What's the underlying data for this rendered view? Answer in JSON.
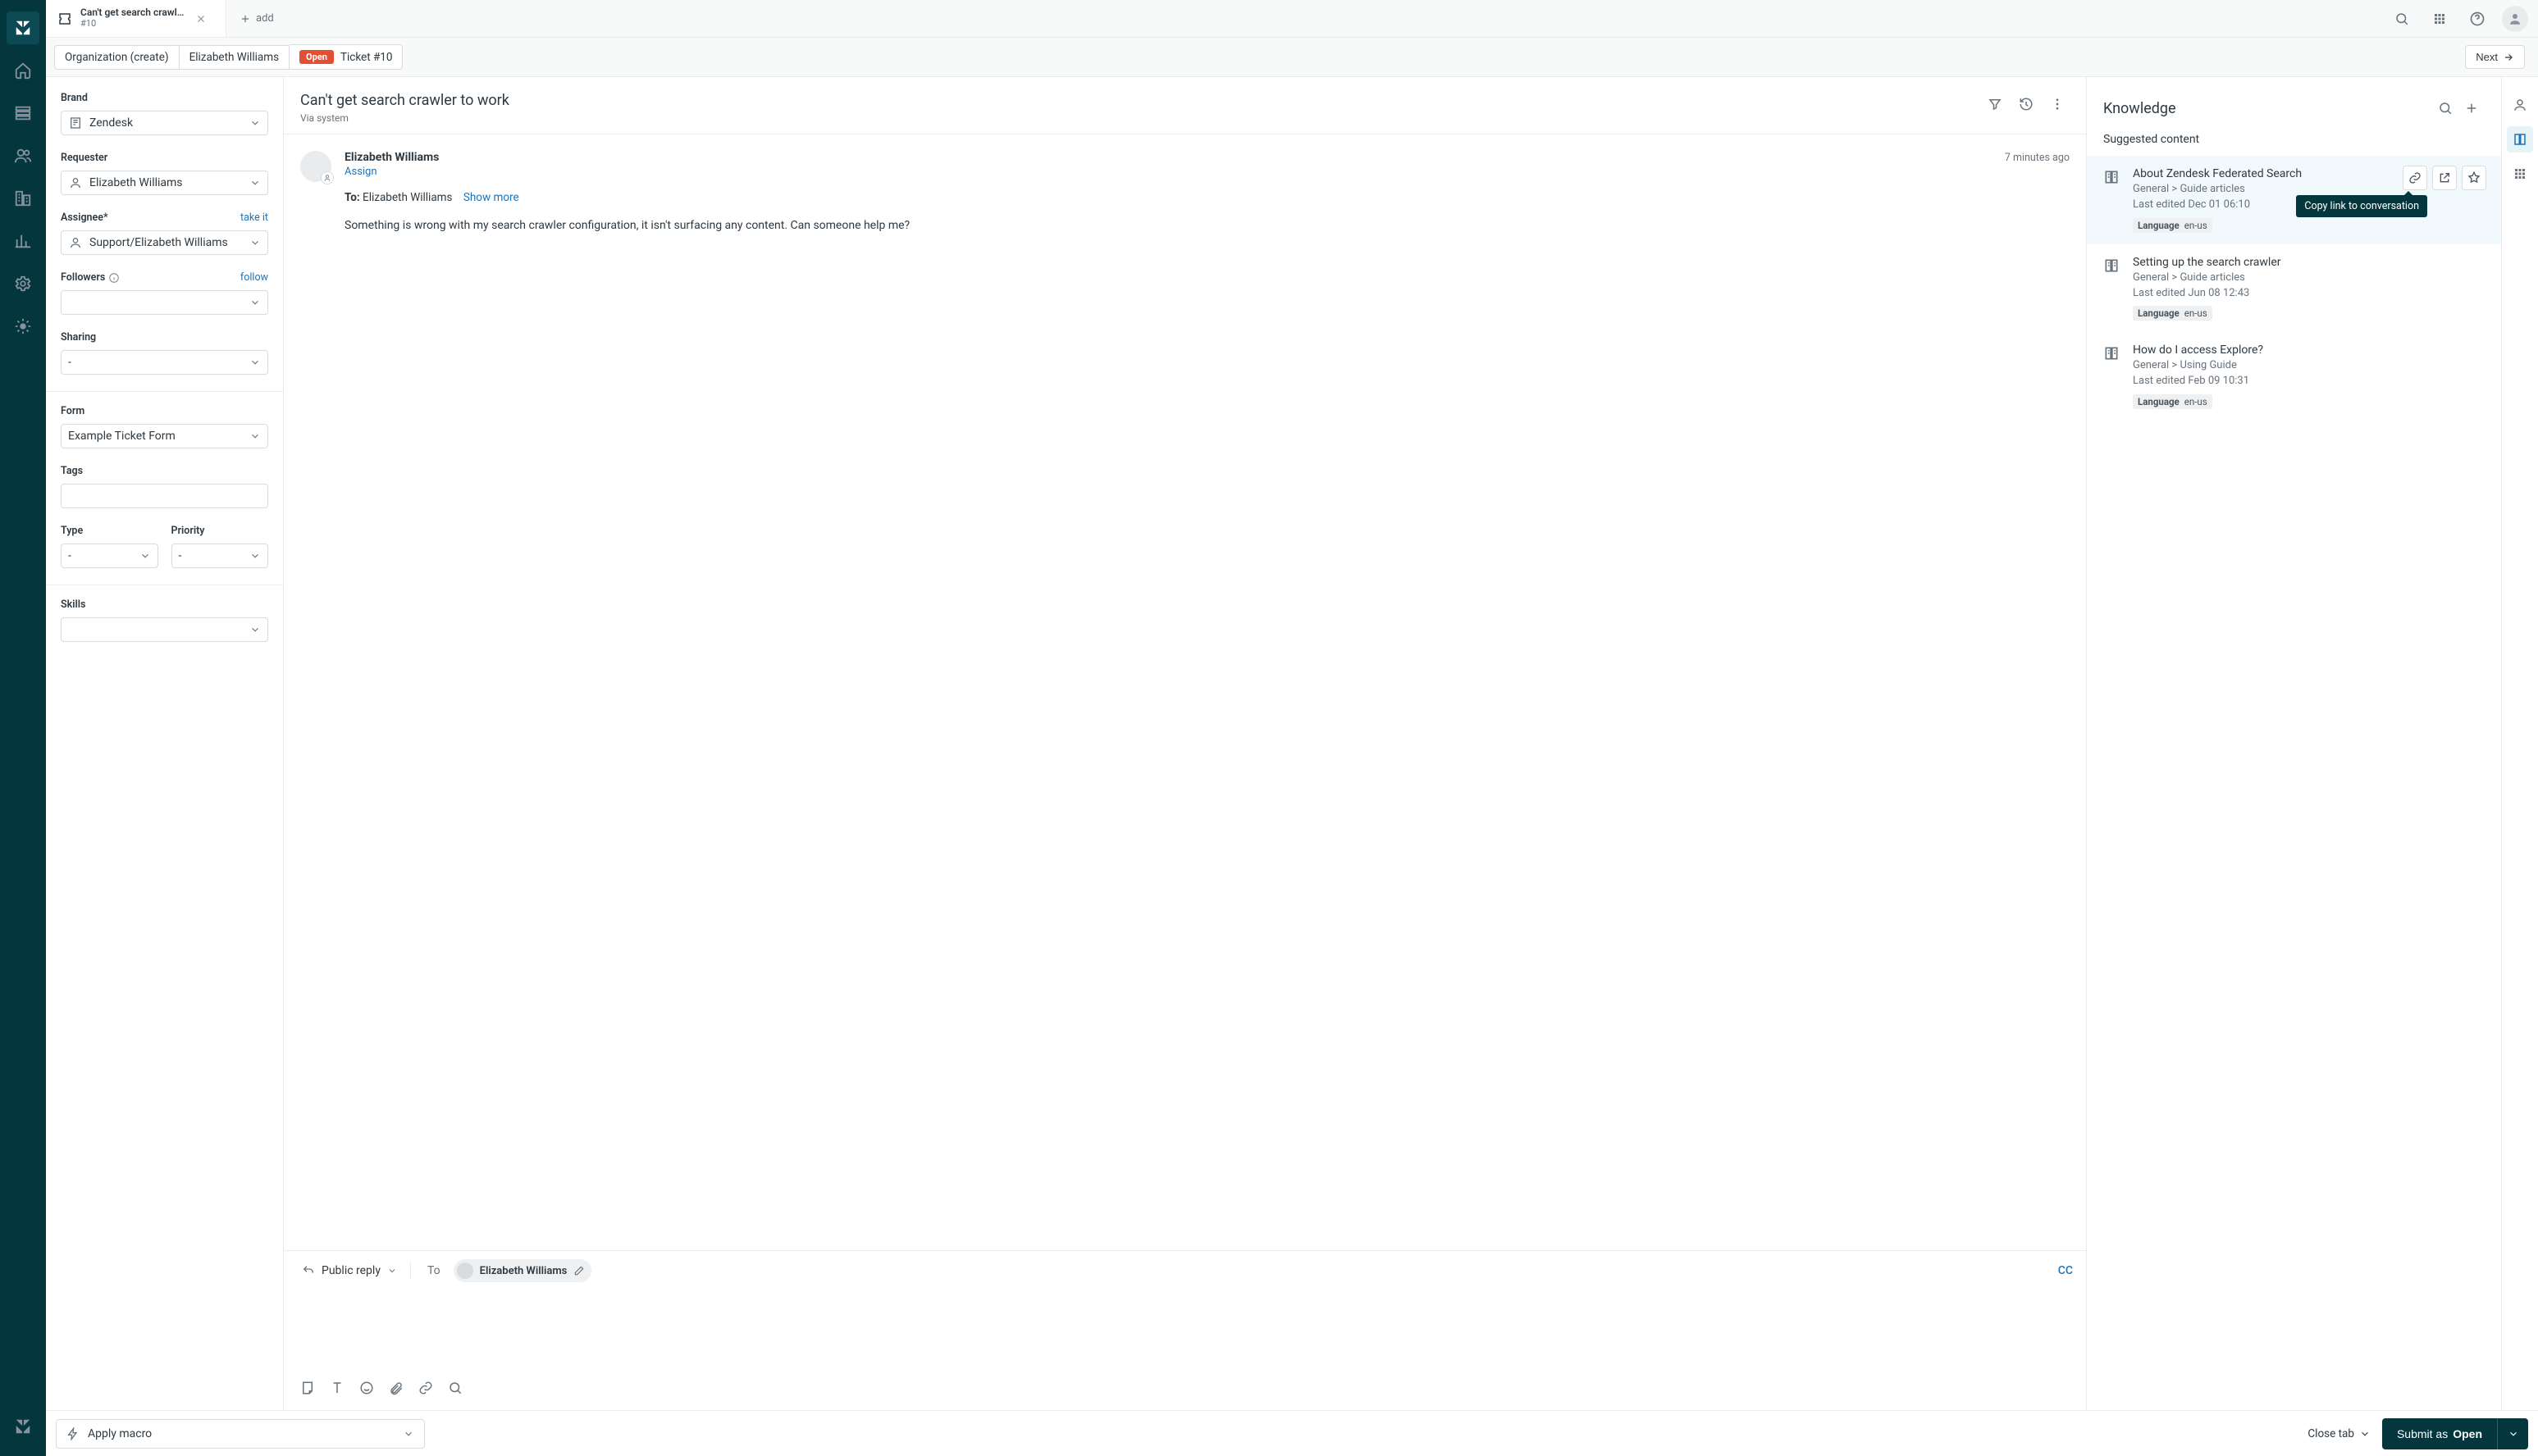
{
  "tab": {
    "title": "Can't get search crawl…",
    "subtitle": "#10",
    "addLabel": "add"
  },
  "breadcrumbs": {
    "org": "Organization (create)",
    "requester": "Elizabeth Williams",
    "status": "Open",
    "ticket": "Ticket #10",
    "next": "Next"
  },
  "sidebar": {
    "brandLabel": "Brand",
    "brandValue": "Zendesk",
    "requesterLabel": "Requester",
    "requesterValue": "Elizabeth Williams",
    "assigneeLabel": "Assignee*",
    "assigneeAction": "take it",
    "assigneeValue": "Support/Elizabeth Williams",
    "followersLabel": "Followers",
    "followersAction": "follow",
    "sharingLabel": "Sharing",
    "sharingValue": "-",
    "formLabel": "Form",
    "formValue": "Example Ticket Form",
    "tagsLabel": "Tags",
    "typeLabel": "Type",
    "typeValue": "-",
    "priorityLabel": "Priority",
    "priorityValue": "-",
    "skillsLabel": "Skills"
  },
  "ticket": {
    "title": "Can't get search crawler to work",
    "via": "Via system",
    "author": "Elizabeth Williams",
    "assign": "Assign",
    "time": "7 minutes ago",
    "toLabel": "To:",
    "toName": "Elizabeth Williams",
    "showMore": "Show more",
    "body": "Something is wrong with my search crawler configuration, it isn't surfacing any content. Can someone help me?"
  },
  "composer": {
    "replyType": "Public reply",
    "toLabel": "To",
    "toChip": "Elizabeth Williams",
    "cc": "CC"
  },
  "kb": {
    "title": "Knowledge",
    "subtitle": "Suggested content",
    "tooltip": "Copy link to conversation",
    "items": [
      {
        "title": "About Zendesk Federated Search",
        "breadcrumb": "General > Guide articles",
        "edited": "Last edited Dec 01 06:10",
        "langKey": "Language",
        "langVal": "en-us"
      },
      {
        "title": "Setting up the search crawler",
        "breadcrumb": "General > Guide articles",
        "edited": "Last edited Jun 08 12:43",
        "langKey": "Language",
        "langVal": "en-us"
      },
      {
        "title": "How do I access Explore?",
        "breadcrumb": "General > Using Guide",
        "edited": "Last edited Feb 09 10:31",
        "langKey": "Language",
        "langVal": "en-us"
      }
    ]
  },
  "footer": {
    "macro": "Apply macro",
    "closeTab": "Close tab",
    "submitPrefix": "Submit as",
    "submitStatus": "Open"
  }
}
